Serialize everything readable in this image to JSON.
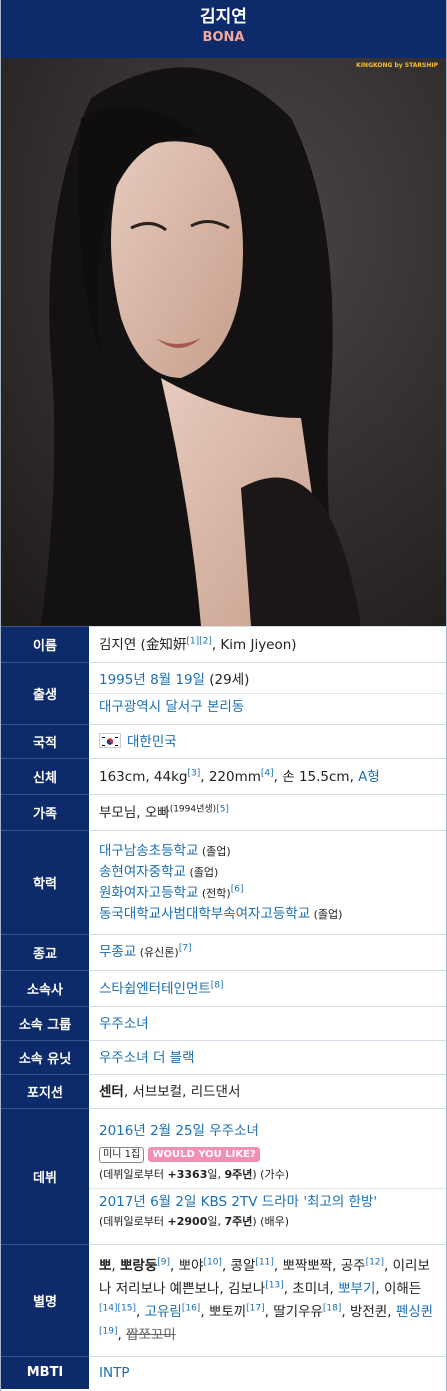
{
  "header": {
    "name": "김지연",
    "stage_name": "BONA"
  },
  "photo": {
    "watermark": "KINGKONG by STARSHIP"
  },
  "rows": {
    "name": {
      "label": "이름",
      "text": "김지연 (金知姸",
      "ref1": "[1]",
      "ref2": "[2]",
      "tail": ", Kim Jiyeon)"
    },
    "birth": {
      "label": "출생",
      "date": "1995년 8월 19일",
      "age": " (29세)",
      "place": "대구광역시 달서구 본리동"
    },
    "nationality": {
      "label": "국적",
      "country": "대한민국"
    },
    "body": {
      "label": "신체",
      "text1": "163cm, 44kg",
      "ref1": "[3]",
      "text2": ", 220mm",
      "ref2": "[4]",
      "text3": ", 손 15.5cm, ",
      "blood": "A형"
    },
    "family": {
      "label": "가족",
      "text": "부모님, 오빠",
      "note": "(1994년생)",
      "ref": "[5]"
    },
    "education": {
      "label": "학력",
      "s1": "대구남송초등학교",
      "s1n": " (졸업)",
      "s2": "송현여자중학교",
      "s2n": " (졸업)",
      "s3": "원화여자고등학교",
      "s3n": " (전학)",
      "s3r": "[6]",
      "s4": "동국대학교사범대학부속여자고등학교",
      "s4n": " (졸업)"
    },
    "religion": {
      "label": "종교",
      "text": "무종교",
      "note": " (유신론)",
      "ref": "[7]"
    },
    "agency": {
      "label": "소속사",
      "text": "스타쉽엔터테인먼트",
      "ref": "[8]"
    },
    "group": {
      "label": "소속 그룹",
      "text": "우주소녀"
    },
    "unit": {
      "label": "소속 유닛",
      "text": "우주소녀 더 블랙"
    },
    "position": {
      "label": "포지션",
      "bold": "센터",
      "text": ", 서브보컬, 리드댄서"
    },
    "debut": {
      "label": "데뷔",
      "singer_date": "2016년 2월 25일 우주소녀",
      "badge_mini": "미니 1집",
      "badge_title": "WOULD YOU LIKE?",
      "singer_days_pre": "(데뷔일로부터 ",
      "singer_days": "+3363",
      "singer_days_mid": "일, ",
      "singer_years": "9주년",
      "singer_role": ") (가수)",
      "actor_date": "2017년 6월 2일 KBS 2TV 드라마 '최고의 한방'",
      "actor_days_pre": "(데뷔일로부터 ",
      "actor_days": "+2900",
      "actor_days_mid": "일, ",
      "actor_years": "7주년",
      "actor_role": ") (배우)"
    },
    "nicknames": {
      "label": "별명",
      "b1": "뽀",
      "t1": ", ",
      "b2": "뽀랑둥",
      "r1": "[9]",
      "t2": ", 뽀야",
      "r2": "[10]",
      "t3": ", 콩알",
      "r3": "[11]",
      "t4": ", 뽀짝뽀짝, 공주",
      "r4": "[12]",
      "t5": ", 이리보나 저리보나 예쁜보나, 김보나",
      "r5": "[13]",
      "t6": ", 초미녀, ",
      "l1": "뽀부기",
      "t7": ", 이해든",
      "r6": "[14]",
      "r7": "[15]",
      "t8": ", ",
      "l2": "고유림",
      "r8": "[16]",
      "t9": ", 뽀토끼",
      "r9": "[17]",
      "t10": ", 딸기우유",
      "r10": "[18]",
      "t11": ", 방전퀸, ",
      "l3": "펜싱퀸",
      "r11": "[19]",
      "t12": ", ",
      "strike": "짭쪼꼬미"
    },
    "mbti": {
      "label": "MBTI",
      "text": "INTP"
    }
  },
  "colors": {
    "header_bg": "#0d2a6b",
    "subtitle": "#f4a99b",
    "link": "#1a6fb4",
    "badge": "#f28fb4"
  }
}
